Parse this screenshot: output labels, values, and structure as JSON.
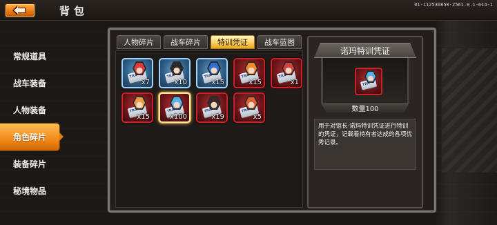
{
  "header": {
    "title": "背包",
    "build_id": "01-112530850-2561.0.1-614-1"
  },
  "sidebar": {
    "items": [
      {
        "label": "常规道具",
        "active": false
      },
      {
        "label": "战车装备",
        "active": false
      },
      {
        "label": "人物装备",
        "active": false
      },
      {
        "label": "角色碎片",
        "active": true
      },
      {
        "label": "装备碎片",
        "active": false
      },
      {
        "label": "秘境物品",
        "active": false
      }
    ]
  },
  "tabs": [
    {
      "label": "人物碎片",
      "active": false
    },
    {
      "label": "战车碎片",
      "active": false
    },
    {
      "label": "特训凭证",
      "active": true
    },
    {
      "label": "战车蓝图",
      "active": false
    }
  ],
  "items": [
    {
      "quantity": "x7",
      "rarity": "blue",
      "hair_color": "#e03a3a"
    },
    {
      "quantity": "x10",
      "rarity": "blue",
      "hair_color": "#2a2a2a"
    },
    {
      "quantity": "x15",
      "rarity": "blue",
      "hair_color": "#2f6fd6"
    },
    {
      "quantity": "x15",
      "rarity": "red",
      "hair_color": "#f08a2a"
    },
    {
      "quantity": "x1",
      "rarity": "red",
      "hair_color": "#d84040"
    },
    {
      "quantity": "x15",
      "rarity": "red",
      "hair_color": "#e8a040"
    },
    {
      "quantity": "x100",
      "rarity": "red",
      "hair_color": "#5ab0e8",
      "selected": true
    },
    {
      "quantity": "x19",
      "rarity": "red",
      "hair_color": "#3a2a2a"
    },
    {
      "quantity": "x5",
      "rarity": "red",
      "hair_color": "#e06030"
    }
  ],
  "detail": {
    "name": "诺玛特训凭证",
    "quantity_label": "数量100",
    "description": "用于对馆长·诺玛特训凭证进行特训的凭证，记载着持有者达成的各项优秀记录。",
    "hair_color": "#5ab0e8"
  },
  "colors": {
    "accent_orange": "#f08a18",
    "tab_active_gold": "#ffd76b",
    "rarity_blue": "#a8d2f0",
    "rarity_red": "#c2262d"
  }
}
